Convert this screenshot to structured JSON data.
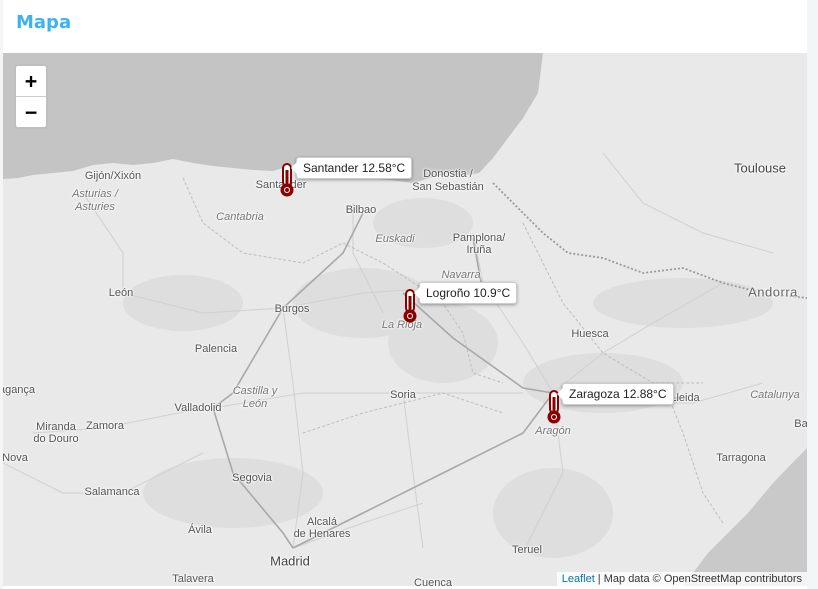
{
  "panel": {
    "title": "Mapa"
  },
  "zoom": {
    "in_label": "+",
    "out_label": "−"
  },
  "markers": [
    {
      "city": "Santander",
      "tooltip": "Santander 12.58°C",
      "icon": "thermometer-icon"
    },
    {
      "city": "Logroño",
      "tooltip": "Logroño 10.9°C",
      "icon": "thermometer-icon"
    },
    {
      "city": "Zaragoza",
      "tooltip": "Zaragoza 12.88°C",
      "icon": "thermometer-icon"
    }
  ],
  "labels": {
    "gijon": "Gijón/Xixón",
    "asturias": "Asturias /",
    "asturies": "Asturies",
    "cantabria": "Cantabria",
    "santander": "Santander",
    "bilbao": "Bilbao",
    "donostia": "Donostia /",
    "sansebastian": "San Sebastián",
    "toulouse": "Toulouse",
    "euskadi": "Euskadi",
    "pamplona": "Pamplona/",
    "iruna": "Iruña",
    "navarra": "Navarra",
    "leon": "León",
    "burgos": "Burgos",
    "logrono": "Logroño",
    "larioja": "La Rioja",
    "andorra": "Andorra",
    "huesca": "Huesca",
    "palencia": "Palencia",
    "castilla": "Castilla y",
    "leonregion": "León",
    "valladolid": "Valladolid",
    "soria": "Soria",
    "zaragoza": "Zaragoza",
    "lleida": "Lleida",
    "catalunya": "Catalunya",
    "aragon": "Aragón",
    "braganca": "agança",
    "miranda": "Miranda",
    "douro": "do Douro",
    "zamora": "Zamora",
    "nova": "Nova",
    "salamanca": "Salamanca",
    "segovia": "Segovia",
    "tarragona": "Tarragona",
    "avila": "Ávila",
    "alcala": "Alcalá",
    "henares": "de Henares",
    "teruel": "Teruel",
    "madrid": "Madrid",
    "talavera": "Talavera",
    "cuenca": "Cuenca",
    "ba": "Ba"
  },
  "attribution": {
    "leaflet": "Leaflet",
    "separator": " | ",
    "text": "Map data © OpenStreetMap contributors"
  },
  "colors": {
    "title": "#3cb3ee",
    "sea": "#c4c4c4",
    "land": "#e9e9e9",
    "marker": "#8b0000"
  }
}
